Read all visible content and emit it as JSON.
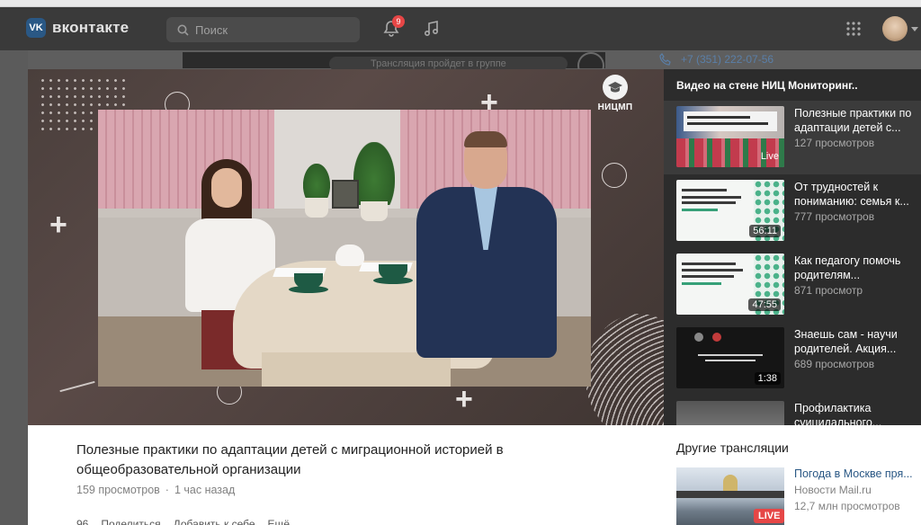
{
  "header": {
    "logo_text": "вконтакте",
    "logo_mark": "VK",
    "search_placeholder": "Поиск",
    "notification_count": "9"
  },
  "background": {
    "phone": "+7 (351) 222-07-56",
    "strip_text": "Трансляция пройдет в группе"
  },
  "player": {
    "brand_label": "НИЦМП"
  },
  "playlist": {
    "title": "Видео на стене НИЦ Мониторинг..",
    "items": [
      {
        "title": "Полезные практики по адаптации детей с...",
        "views": "127 просмотров",
        "badge": "Live"
      },
      {
        "title": "От трудностей к пониманию: семья к...",
        "views": "777 просмотров",
        "badge": "56:11"
      },
      {
        "title": "Как педагогу помочь родителям...",
        "views": "871 просмотр",
        "badge": "47:55"
      },
      {
        "title": "Знаешь сам - научи родителей. Акция...",
        "views": "689 просмотров",
        "badge": "1:38"
      },
      {
        "title": "Профилактика суицидального...",
        "views": "",
        "badge": ""
      }
    ]
  },
  "video": {
    "title": "Полезные практики по адаптации детей с миграционной историей в общеобразовательной организации",
    "views": "159 просмотров",
    "separator": "·",
    "time": "1 час назад",
    "actions": [
      "96",
      "Поделиться",
      "Добавить к себе",
      "Ещё"
    ]
  },
  "other_streams": {
    "title": "Другие трансляции",
    "item": {
      "name": "Погода в Москве пря...",
      "source": "Новости Mail.ru",
      "views": "12,7 млн просмотров",
      "badge": "LIVE"
    }
  },
  "colors": {
    "accent": "#2a5885",
    "live": "#e64646",
    "header_bg": "#3a3a3a",
    "panel_bg": "#2c2c2c"
  }
}
